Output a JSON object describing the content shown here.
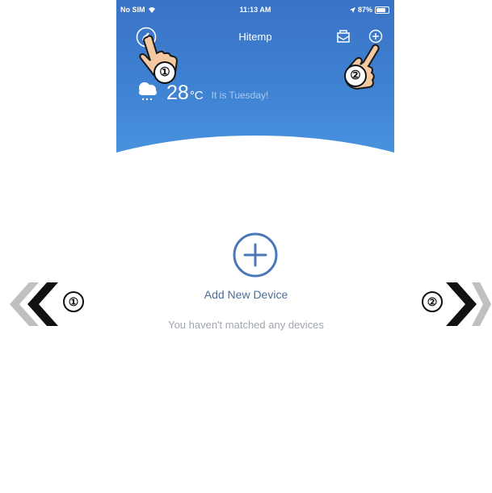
{
  "status_bar": {
    "carrier": "No SIM",
    "time": "11:13 AM",
    "battery": "87%"
  },
  "header": {
    "title": "Hitemp"
  },
  "weather": {
    "icon": "cloud-rain-icon",
    "temperature": "28",
    "unit": "°C",
    "day_text": "It is Tuesday!"
  },
  "main": {
    "add_label": "Add New Device",
    "empty_message": "You haven't matched any devices"
  },
  "callouts": {
    "one": "①",
    "two": "②"
  },
  "colors": {
    "header_blue": "#3f83d3",
    "accent": "#4b78b8",
    "arrow_dark": "#111111",
    "arrow_light": "#c0c0c0"
  }
}
